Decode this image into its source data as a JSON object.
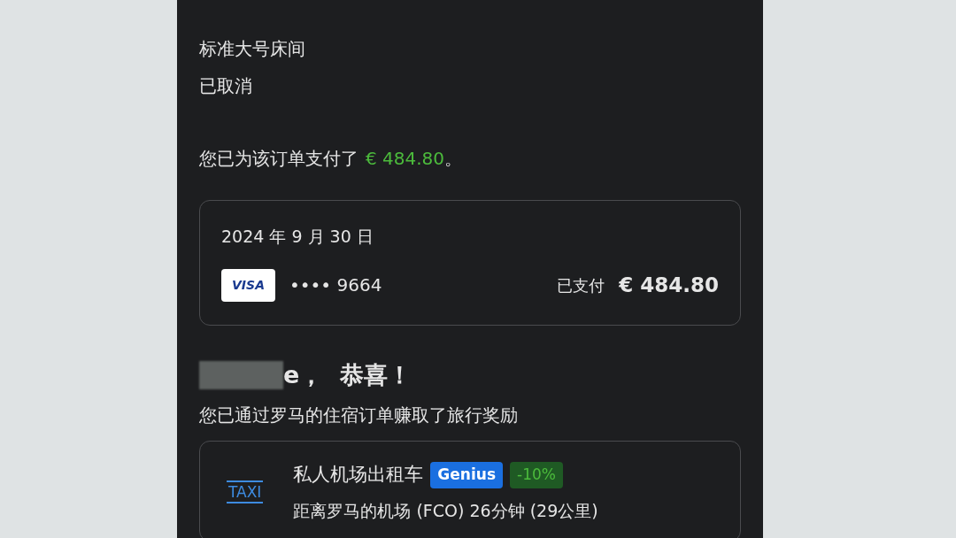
{
  "booking": {
    "room": "标准大号床间",
    "status": "已取消"
  },
  "payment_notice": {
    "text": "您已为该订单支付了",
    "amount": "€ 484.80",
    "end": "。"
  },
  "payment_card": {
    "date": "2024 年 9 月 30 日",
    "card_brand": "VISA",
    "card_number": "•••• 9664",
    "paid_label": "已支付",
    "amount": "€ 484.80"
  },
  "reward": {
    "greeting": "e，  恭喜！",
    "subtitle": "您已通过罗马的住宿订单赚取了旅行奖励"
  },
  "offer": {
    "icon_text": "TAXI",
    "title": "私人机场出租车",
    "badge": "Genius",
    "discount": "-10%",
    "detail": "距离罗马的机场 (FCO) 26分钟 (29公里)"
  }
}
